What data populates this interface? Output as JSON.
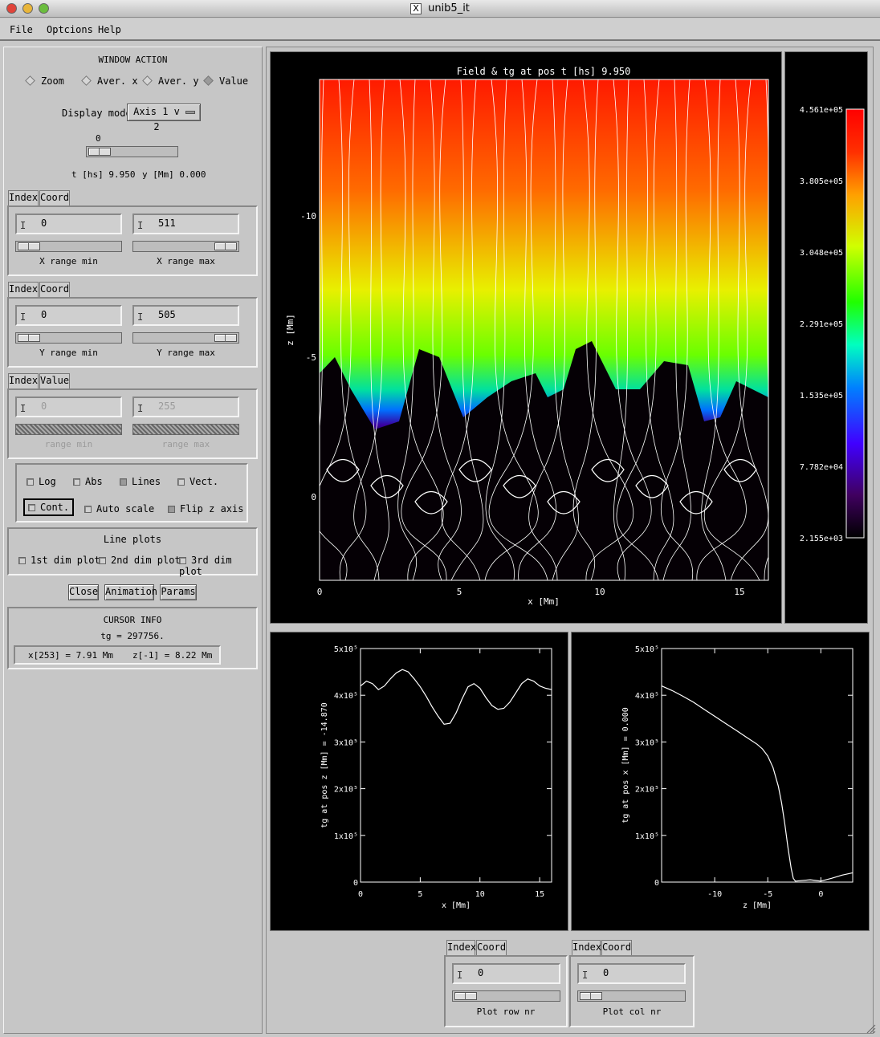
{
  "window": {
    "title": "unib5_it",
    "x_icon": "X"
  },
  "menu": [
    "File",
    "Optcions",
    "Help"
  ],
  "window_action": {
    "title": "WINDOW ACTION",
    "options": [
      "Zoom",
      "Aver. x",
      "Aver. y",
      "Value"
    ],
    "display_mode_label": "Display mode",
    "display_mode_value": "Axis 1 v 2",
    "time_slider_value": "0",
    "time_readout": "t [hs] 9.950",
    "y_readout": "y [Mm] 0.000"
  },
  "x_range": {
    "tabs": [
      "Index",
      "Coord"
    ],
    "min_value": "0",
    "max_value": "511",
    "min_label": "X range min",
    "max_label": "X range max"
  },
  "y_range": {
    "tabs": [
      "Index",
      "Coord"
    ],
    "min_value": "0",
    "max_value": "505",
    "min_label": "Y range min",
    "max_label": "Y range max"
  },
  "value_range": {
    "tabs": [
      "Index",
      "Value"
    ],
    "min_value": "0",
    "max_value": "255",
    "min_label": "range min",
    "max_label": "range max"
  },
  "checkboxes": {
    "log": "Log",
    "abs": "Abs",
    "lines": "Lines",
    "vect": "Vect.",
    "cont": "Cont.",
    "auto_scale": "Auto scale",
    "flip_z": "Flip z axis"
  },
  "line_plots": {
    "title": "Line plots",
    "items": [
      "1st dim plot",
      "2nd dim plot",
      "3rd dim plot"
    ]
  },
  "buttons": {
    "close": "Close",
    "animation": "Animation",
    "params": "Params"
  },
  "cursor_info": {
    "title": "CURSOR INFO",
    "value": "tg = 297756.",
    "x": "x[253] = 7.91 Mm",
    "z": "z[-1] = 8.22 Mm"
  },
  "main_plot": {
    "title": "Field & tg at pos t [hs]    9.950",
    "xlabel": "x [Mm]",
    "ylabel": "z [Mm]",
    "xticks": [
      "0",
      "5",
      "10",
      "15"
    ],
    "yticks": [
      "-10",
      "-5",
      "0"
    ]
  },
  "colorbar": {
    "labels": [
      "4.561e+05",
      "3.805e+05",
      "3.048e+05",
      "2.291e+05",
      "1.535e+05",
      "7.782e+04",
      "2.155e+03"
    ]
  },
  "bottom_controls": {
    "row": {
      "tabs": [
        "Index",
        "Coord"
      ],
      "value": "0",
      "label": "Plot row nr"
    },
    "col": {
      "tabs": [
        "Index",
        "Coord"
      ],
      "value": "0",
      "label": "Plot col nr"
    }
  },
  "chart_data": [
    {
      "type": "line",
      "title": "",
      "xlabel": "x [Mm]",
      "ylabel": "tg at pos z [Mm] = -14.870",
      "xlim": [
        0,
        16
      ],
      "ylim": [
        0,
        500000
      ],
      "xticks": [
        "0",
        "5",
        "10",
        "15"
      ],
      "yticks": [
        "0",
        "1x10⁵",
        "2x10⁵",
        "3x10⁵",
        "4x10⁵",
        "5x10⁵"
      ],
      "x": [
        0,
        0.5,
        1,
        1.5,
        2,
        2.5,
        3,
        3.5,
        4,
        4.5,
        5,
        5.5,
        6,
        6.5,
        7,
        7.5,
        8,
        8.5,
        9,
        9.5,
        10,
        10.5,
        11,
        11.5,
        12,
        12.5,
        13,
        13.5,
        14,
        14.5,
        15,
        15.5,
        16
      ],
      "values": [
        420000,
        430000,
        425000,
        412000,
        420000,
        435000,
        448000,
        455000,
        450000,
        435000,
        418000,
        398000,
        375000,
        355000,
        338000,
        340000,
        362000,
        392000,
        418000,
        425000,
        415000,
        395000,
        378000,
        370000,
        372000,
        385000,
        405000,
        425000,
        435000,
        430000,
        420000,
        415000,
        412000
      ]
    },
    {
      "type": "line",
      "title": "",
      "xlabel": "z [Mm]",
      "ylabel": "tg at pos x [Mm] = 0.000",
      "xlim": [
        -15,
        3
      ],
      "ylim": [
        0,
        500000
      ],
      "xticks": [
        "-10",
        "-5",
        "0"
      ],
      "yticks": [
        "0",
        "1x10⁵",
        "2x10⁵",
        "3x10⁵",
        "4x10⁵",
        "5x10⁵"
      ],
      "x": [
        -15,
        -14,
        -13,
        -12,
        -11,
        -10,
        -9,
        -8,
        -7,
        -6,
        -5.5,
        -5,
        -4.5,
        -4,
        -3.7,
        -3.4,
        -3.1,
        -2.8,
        -2.6,
        -2.4,
        -2,
        -1,
        0,
        1,
        2,
        3
      ],
      "values": [
        420000,
        410000,
        398000,
        385000,
        370000,
        355000,
        340000,
        325000,
        310000,
        295000,
        285000,
        270000,
        245000,
        205000,
        170000,
        125000,
        75000,
        30000,
        8000,
        2000,
        3000,
        5000,
        2000,
        8000,
        15000,
        20000
      ]
    }
  ]
}
